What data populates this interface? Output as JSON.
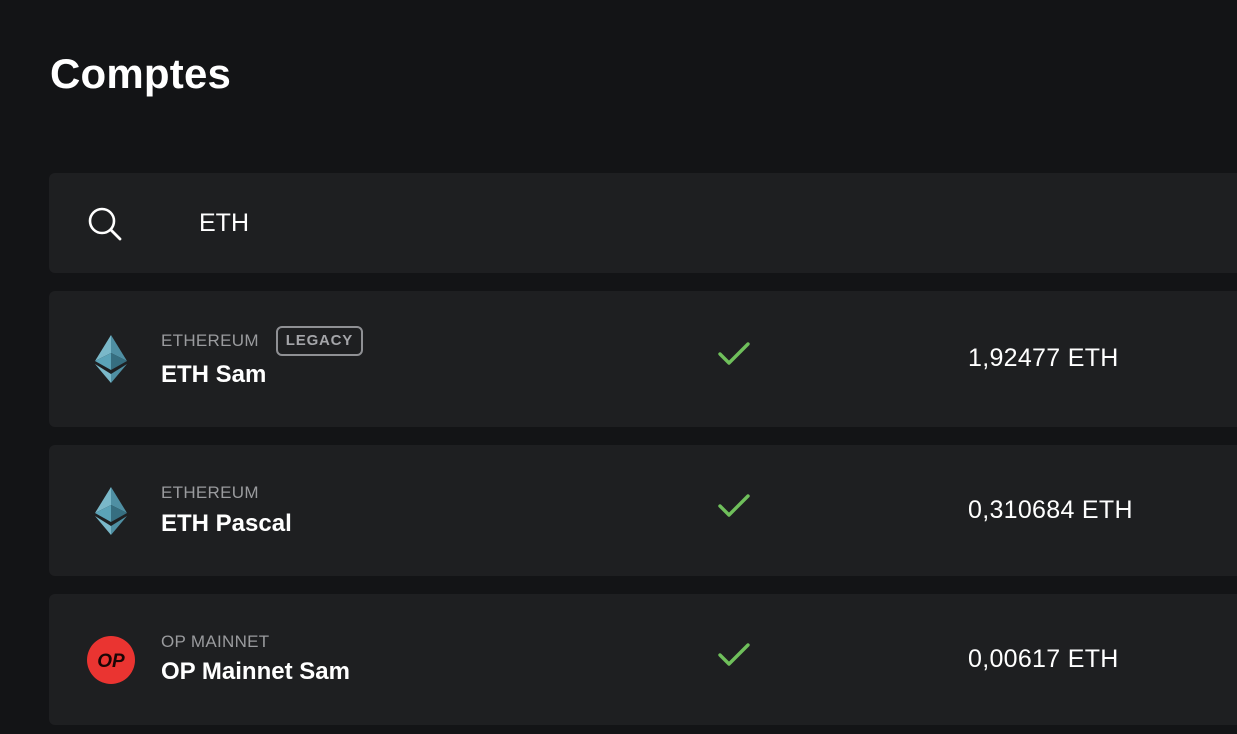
{
  "page": {
    "title": "Comptes"
  },
  "search": {
    "value": "ETH",
    "icon": "search-icon"
  },
  "accounts": [
    {
      "network": "ETHEREUM",
      "badge": "LEGACY",
      "name": "ETH Sam",
      "synced": true,
      "balance": "1,92477 ETH",
      "icon": "ethereum-icon"
    },
    {
      "network": "ETHEREUM",
      "name": "ETH Pascal",
      "synced": true,
      "balance": "0,310684 ETH",
      "icon": "ethereum-icon"
    },
    {
      "network": "OP MAINNET",
      "name": "OP Mainnet Sam",
      "synced": true,
      "balance": "0,00617 ETH",
      "icon": "op-mainnet-icon",
      "icon_text": "OP"
    }
  ],
  "colors": {
    "background": "#131416",
    "card": "#1e1f21",
    "check": "#6fbf5b",
    "op_red": "#ea3431"
  }
}
